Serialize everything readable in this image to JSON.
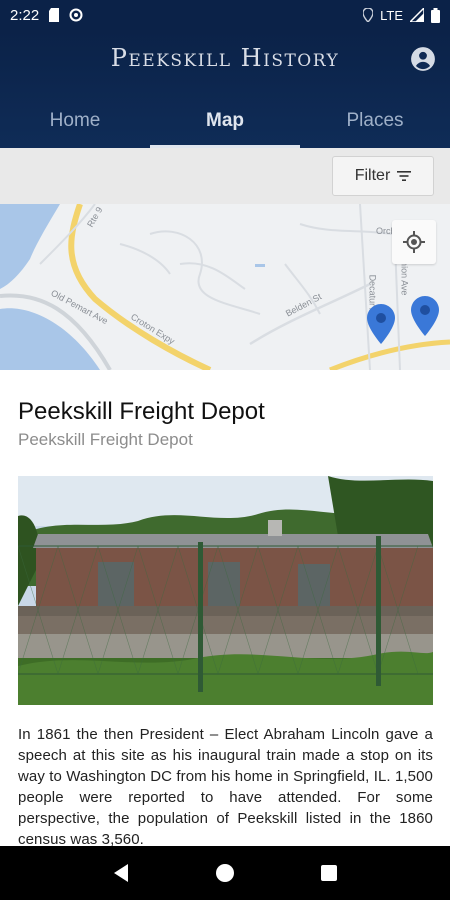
{
  "status_bar": {
    "time": "2:22",
    "network": "LTE"
  },
  "app": {
    "title": "Peekskill History"
  },
  "tabs": [
    {
      "label": "Home",
      "active": false
    },
    {
      "label": "Map",
      "active": true
    },
    {
      "label": "Places",
      "active": false
    }
  ],
  "filter": {
    "label": "Filter"
  },
  "map": {
    "labels": {
      "road_rte": "Rte 9",
      "old_pemart": "Old Pemart Ave",
      "croton_expy": "Croton Expy",
      "belden": "Belden St",
      "decatur": "Decatur Ave",
      "union": "Union Ave",
      "orchard": "Orch"
    }
  },
  "place": {
    "title": "Peekskill Freight Depot",
    "subtitle": "Peekskill Freight Depot",
    "description": "In 1861 the then President – Elect Abraham Lincoln gave a speech at this site as his inaugural train made a stop on its way to Washington DC from his home in Springfield, IL. 1,500 people were reported to have attended. For some perspective, the population of Peekskill listed in the 1860 census was 3,560."
  },
  "colors": {
    "app_bar": "#0b2248",
    "pin": "#3a78d8"
  }
}
